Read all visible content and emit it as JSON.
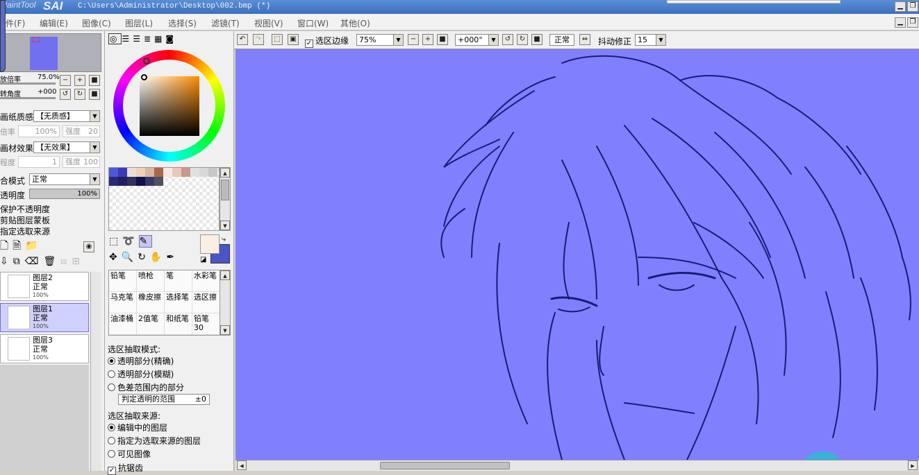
{
  "title": {
    "logo_small": "PaintTool",
    "logo_big": "SAI",
    "path": "C:\\Users\\Administrator\\Desktop\\002.bmp (*)"
  },
  "menu": [
    "件(F)",
    "编辑(E)",
    "图像(C)",
    "图层(L)",
    "选择(S)",
    "滤镜(T)",
    "视图(V)",
    "窗口(W)",
    "其他(O)"
  ],
  "navigator": {
    "zoom_label": "放倍率",
    "zoom_value": "75.0%",
    "angle_label": "转角度",
    "angle_value": "+000"
  },
  "paper": {
    "texture_label": "画纸质感",
    "texture_value": "【无质感】",
    "scale_label": "倍率",
    "scale_value": "100%",
    "strength_label": "强度",
    "strength_value": "20",
    "effect_label": "画材效果",
    "effect_value": "【无效果】",
    "width_label": "程度",
    "width_value": "1",
    "effect_strength_label": "强度",
    "effect_strength_value": "100"
  },
  "blend": {
    "mode_label": "合模式",
    "mode_value": "正常",
    "opacity_label": "透明度",
    "opacity_value": "100%",
    "preserve_opacity": "保护不透明度",
    "clipping": "剪贴图层蒙板",
    "selection_source": "指定选取来源"
  },
  "layers": [
    {
      "name": "图层2",
      "mode": "正常",
      "opacity": "100%"
    },
    {
      "name": "图层1",
      "mode": "正常",
      "opacity": "100%"
    },
    {
      "name": "图层3",
      "mode": "正常",
      "opacity": "100%"
    }
  ],
  "swatches": [
    "#4a5ad8",
    "#3a3ab8",
    "#e8e0d8",
    "#f0d0b8",
    "#d8b8a0",
    "#a86848",
    "#f8e8e0",
    "#e8c8b8",
    "#c89888",
    "#e0e0e0",
    "#d8d8d8",
    "#c8c8c8",
    "#282878",
    "#202060",
    "#303058",
    "#101050",
    "#383868",
    "#505060"
  ],
  "colors": {
    "foreground": "#fbeee2",
    "background": "#4a55c8",
    "canvas": "#8080ff",
    "line": "#1a1a7a"
  },
  "tools": [
    {
      "name": "铅笔"
    },
    {
      "name": "喷枪"
    },
    {
      "name": "笔"
    },
    {
      "name": "水彩笔"
    },
    {
      "name": "马克笔"
    },
    {
      "name": "橡皮擦"
    },
    {
      "name": "选择笔"
    },
    {
      "name": "选区擦"
    },
    {
      "name": "油漆桶"
    },
    {
      "name": "2值笔"
    },
    {
      "name": "和纸笔"
    },
    {
      "name": "铅笔30"
    }
  ],
  "magic_wand": {
    "mode_title": "选区抽取模式:",
    "modes": [
      "透明部分(精确)",
      "透明部分(模糊)",
      "色差范围内的部分"
    ],
    "range_label": "判定透明的范围",
    "range_value": "±0",
    "source_title": "选区抽取来源:",
    "sources": [
      "编辑中的图层",
      "指定为选取来源的图层",
      "可见图像"
    ],
    "antialias": "抗锯齿"
  },
  "canvas_toolbar": {
    "selection_edge": "选区边缘",
    "zoom": "75%",
    "angle": "+000°",
    "blend": "正常",
    "stabilizer_label": "抖动修正",
    "stabilizer_value": "15"
  }
}
